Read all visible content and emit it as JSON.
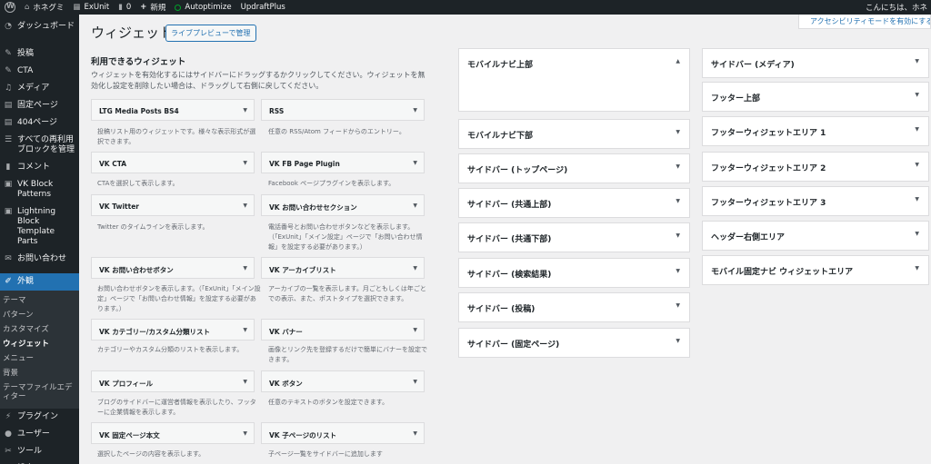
{
  "adminbar": {
    "site_name": "ホネグミ",
    "theme_item": "ExUnit",
    "comments_count": "0",
    "new_label": "新規",
    "plugin1": "Autoptimize",
    "plugin2": "UpdraftPlus",
    "greeting": "こんにちは、ホネ"
  },
  "accessibility_link": "アクセシビリティモードを有効にする",
  "sidebar": {
    "dashboard": "ダッシュボード",
    "items": [
      {
        "label": "投稿",
        "icon": "pin-icon"
      },
      {
        "label": "CTA",
        "icon": "pin-icon"
      },
      {
        "label": "メディア",
        "icon": "media-icon"
      },
      {
        "label": "固定ページ",
        "icon": "page-icon"
      },
      {
        "label": "404ページ",
        "icon": "page-icon"
      },
      {
        "label": "すべての再利用ブロックを管理",
        "icon": "list-icon"
      },
      {
        "label": "コメント",
        "icon": "comment-icon"
      },
      {
        "label": "VK Block Patterns",
        "icon": "block-icon"
      },
      {
        "label": "Lightning Block Template Parts",
        "icon": "block-icon"
      },
      {
        "label": "お問い合わせ",
        "icon": "mail-icon"
      }
    ],
    "appearance": "外観",
    "submenu": [
      "テーマ",
      "パターン",
      "カスタマイズ",
      "ウィジェット",
      "メニュー",
      "背景",
      "テーマファイルエディター"
    ],
    "bottom": [
      {
        "label": "プラグイン",
        "icon": "plugin-icon"
      },
      {
        "label": "ユーザー",
        "icon": "user-icon"
      },
      {
        "label": "ツール",
        "icon": "tool-icon"
      },
      {
        "label": "設定",
        "icon": "settings-icon"
      }
    ]
  },
  "page": {
    "title": "ウィジェット",
    "live_preview": "ライブプレビューで管理",
    "available_title": "利用できるウィジェット",
    "available_desc": "ウィジェットを有効化するにはサイドバーにドラッグするかクリックしてください。ウィジェットを無効化し設定を削除したい場合は、ドラッグして右側に戻してください。"
  },
  "widgets": [
    {
      "name": "LTG Media Posts BS4",
      "desc": "投稿リスト用のウィジェットです。様々な表示形式が選択できます。"
    },
    {
      "name": "RSS",
      "desc": "任意の RSS/Atom フィードからのエントリー。"
    },
    {
      "name": "VK CTA",
      "desc": "CTAを選択して表示します。"
    },
    {
      "name": "VK FB Page Plugin",
      "desc": "Facebook ページプラグインを表示します。"
    },
    {
      "name": "VK Twitter",
      "desc": "Twitter のタイムラインを表示します。"
    },
    {
      "name": "VK お問い合わせセクション",
      "desc": "電話番号とお問い合わせボタンなどを表示します。（「ExUnit」「メイン設定」ページで「お問い合わせ情報」を設定する必要があります。）"
    },
    {
      "name": "VK お問い合わせボタン",
      "desc": "お問い合わせボタンを表示します。（「ExUnit」「メイン設定」ページで「お問い合わせ情報」を設定する必要があります。）"
    },
    {
      "name": "VK アーカイブリスト",
      "desc": "アーカイブの一覧を表示します。月ごともしくは年ごとでの表示、また、ポストタイプを選択できます。"
    },
    {
      "name": "VK カテゴリー/カスタム分類リスト",
      "desc": "カテゴリーやカスタム分類のリストを表示します。"
    },
    {
      "name": "VK バナー",
      "desc": "画像とリンク先を登録するだけで簡単にバナーを設定できます。"
    },
    {
      "name": "VK プロフィール",
      "desc": "ブログのサイドバーに運営者情報を表示したり、フッターに企業情報を表示します。"
    },
    {
      "name": "VK ボタン",
      "desc": "任意のテキストのボタンを設定できます。"
    },
    {
      "name": "VK 固定ページ本文",
      "desc": "選択したページの内容を表示します。"
    },
    {
      "name": "VK 子ページのリスト",
      "desc": "子ページ一覧をサイドバーに追加します"
    }
  ],
  "areas_col1": [
    "モバイルナビ上部",
    "モバイルナビ下部",
    "サイドバー (トップページ)",
    "サイドバー (共通上部)",
    "サイドバー (共通下部)",
    "サイドバー (検索結果)",
    "サイドバー (投稿)",
    "サイドバー (固定ページ)"
  ],
  "areas_col2": [
    "サイドバー (メディア)",
    "フッター上部",
    "フッターウィジェットエリア 1",
    "フッターウィジェットエリア 2",
    "フッターウィジェットエリア 3",
    "ヘッダー右側エリア",
    "モバイル固定ナビ ウィジェットエリア"
  ],
  "colors": {
    "admin_dark": "#1d2327",
    "accent": "#2271b1",
    "background": "#f0f0f1"
  }
}
